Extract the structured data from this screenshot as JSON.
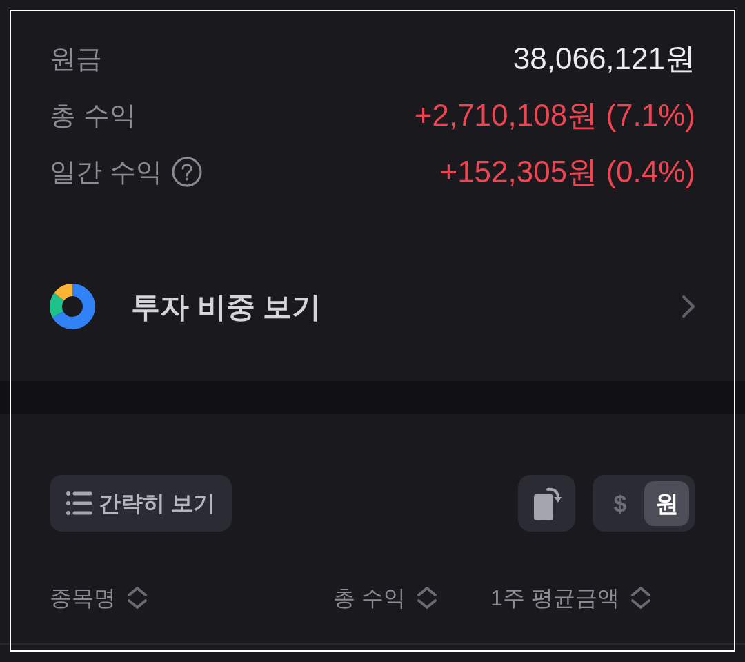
{
  "summary": [
    {
      "label": "원금",
      "value": "38,066,121원",
      "kind": "plain",
      "help": false
    },
    {
      "label": "총 수익",
      "value": "+2,710,108원 (7.1%)",
      "kind": "gain",
      "help": false
    },
    {
      "label": "일간 수익",
      "value": "+152,305원 (0.4%)",
      "kind": "gain",
      "help": true
    }
  ],
  "allocation_link": {
    "label": "투자 비중 보기"
  },
  "toolbar": {
    "view_button": {
      "label": "간략히 보기"
    },
    "currency_toggle": [
      {
        "label": "$",
        "selected": false
      },
      {
        "label": "원",
        "selected": true
      }
    ]
  },
  "table": {
    "columns": [
      {
        "label": "종목명"
      },
      {
        "label": "총 수익"
      },
      {
        "label": "1주 평균금액"
      }
    ]
  }
}
